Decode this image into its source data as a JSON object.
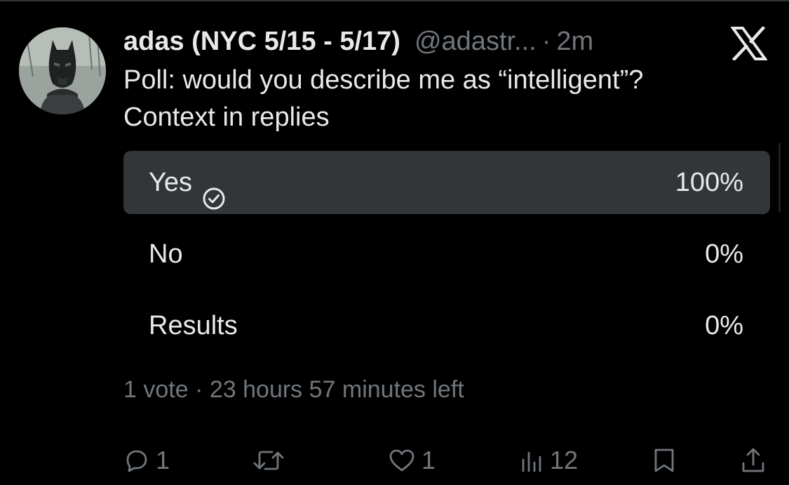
{
  "tweet": {
    "author_name": "adas (NYC 5/15 - 5/17)",
    "handle": "@adastr...",
    "separator": "·",
    "timestamp": "2m",
    "text_lines": [
      "Poll: would you describe me as “intelligent”?",
      "Context in replies"
    ]
  },
  "poll": {
    "options": [
      {
        "label": "Yes",
        "percent_text": "100%",
        "percent": 100,
        "winner": true
      },
      {
        "label": "No",
        "percent_text": "0%",
        "percent": 0,
        "winner": false
      },
      {
        "label": "Results",
        "percent_text": "0%",
        "percent": 0,
        "winner": false
      }
    ],
    "votes": "1 vote",
    "meta_separator": "·",
    "time_left": "23 hours 57 minutes left"
  },
  "actions": {
    "replies": "1",
    "reposts": "",
    "likes": "1",
    "views": "12"
  },
  "colors": {
    "background": "#000000",
    "text_primary": "#e7e9ea",
    "text_secondary": "#71767b",
    "poll_fill": "#333639"
  },
  "icons": {
    "brand": "x-logo-icon",
    "winner": "check-circle-icon",
    "reply": "reply-icon",
    "repost": "repost-icon",
    "like": "heart-icon",
    "views": "views-icon",
    "bookmark": "bookmark-icon",
    "share": "share-icon"
  }
}
